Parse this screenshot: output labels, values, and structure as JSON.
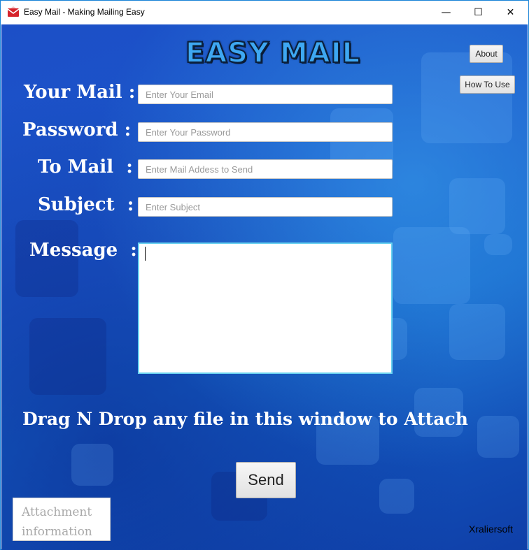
{
  "window": {
    "title": "Easy Mail - Making Mailing Easy",
    "controls": {
      "minimize": "—",
      "maximize": "☐",
      "close": "✕"
    }
  },
  "logo": "EASY MAIL",
  "buttons": {
    "about": "About",
    "how_to_use": "How To Use",
    "send": "Send"
  },
  "form": {
    "your_mail": {
      "label": "Your Mail :",
      "placeholder": "Enter Your Email",
      "value": ""
    },
    "password": {
      "label": "Password :",
      "placeholder": "Enter Your Password",
      "value": ""
    },
    "to_mail": {
      "label": "To Mail  :",
      "placeholder": "Enter Mail Addess to Send",
      "value": ""
    },
    "subject": {
      "label": "Subject  :",
      "placeholder": "Enter Subject",
      "value": ""
    },
    "message": {
      "label": "Message  :",
      "value": ""
    }
  },
  "drag_hint": "Drag N Drop any file in this window to Attach",
  "attachment_info": {
    "line1": "Attachment",
    "line2": "information"
  },
  "footer_brand": "Xraliersoft",
  "colors": {
    "background_blue": "#1a56c9",
    "accent_cyan": "#6ad2f0",
    "logo_blue": "#3ea8f2"
  },
  "icons": {
    "app": "mail-envelope-icon"
  }
}
